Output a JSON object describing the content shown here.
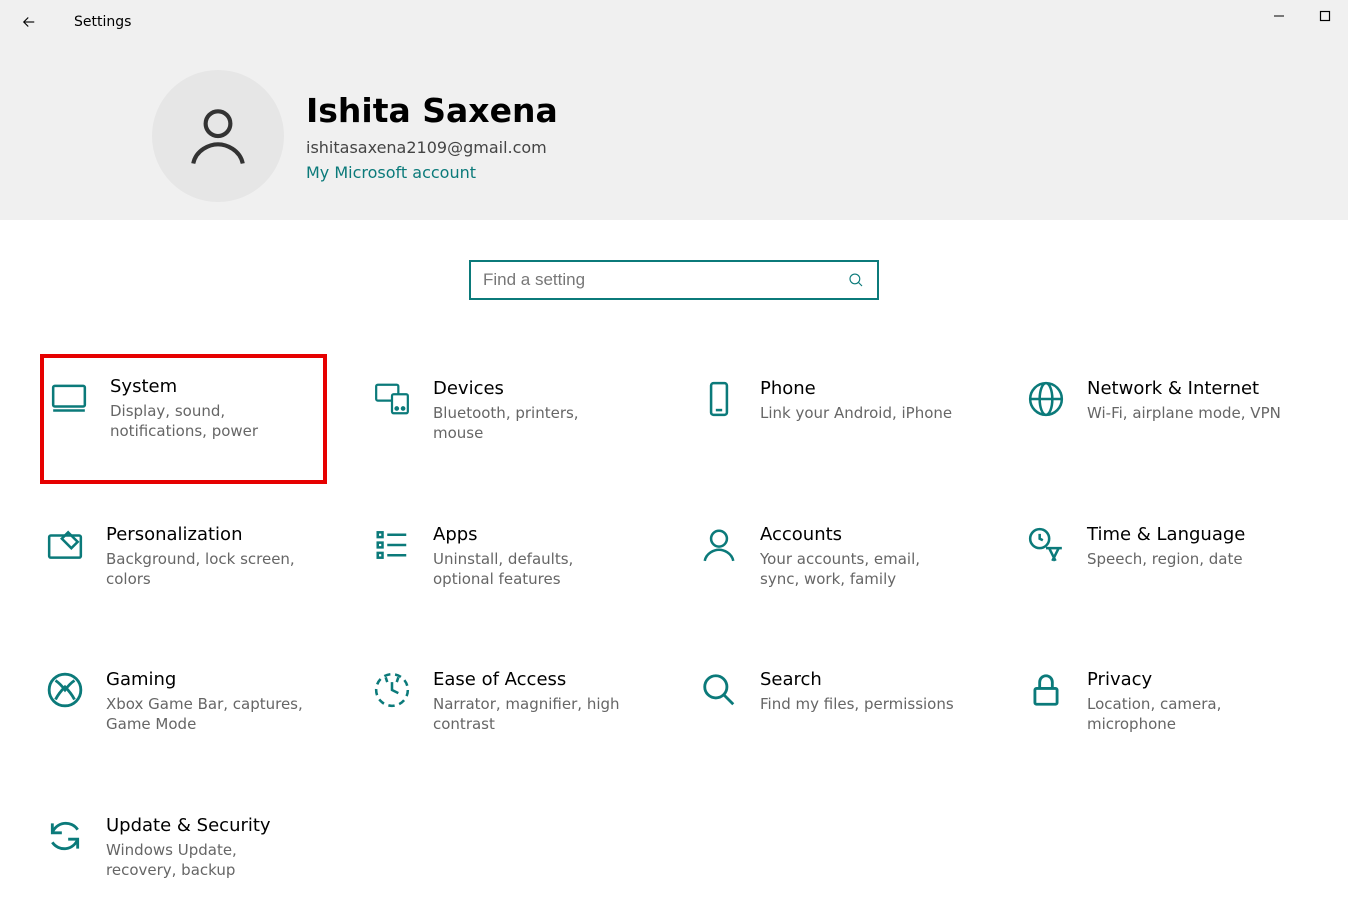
{
  "window": {
    "title": "Settings"
  },
  "account": {
    "name": "Ishita Saxena",
    "email": "ishitasaxena2109@gmail.com",
    "link": "My Microsoft account"
  },
  "search": {
    "placeholder": "Find a setting"
  },
  "tiles": {
    "system": {
      "title": "System",
      "desc": "Display, sound, notifications, power"
    },
    "devices": {
      "title": "Devices",
      "desc": "Bluetooth, printers, mouse"
    },
    "phone": {
      "title": "Phone",
      "desc": "Link your Android, iPhone"
    },
    "network": {
      "title": "Network & Internet",
      "desc": "Wi-Fi, airplane mode, VPN"
    },
    "personalization": {
      "title": "Personalization",
      "desc": "Background, lock screen, colors"
    },
    "apps": {
      "title": "Apps",
      "desc": "Uninstall, defaults, optional features"
    },
    "accounts": {
      "title": "Accounts",
      "desc": "Your accounts, email, sync, work, family"
    },
    "time": {
      "title": "Time & Language",
      "desc": "Speech, region, date"
    },
    "gaming": {
      "title": "Gaming",
      "desc": "Xbox Game Bar, captures, Game Mode"
    },
    "ease": {
      "title": "Ease of Access",
      "desc": "Narrator, magnifier, high contrast"
    },
    "search": {
      "title": "Search",
      "desc": "Find my files, permissions"
    },
    "privacy": {
      "title": "Privacy",
      "desc": "Location, camera, microphone"
    },
    "update": {
      "title": "Update & Security",
      "desc": "Windows Update, recovery, backup"
    }
  }
}
